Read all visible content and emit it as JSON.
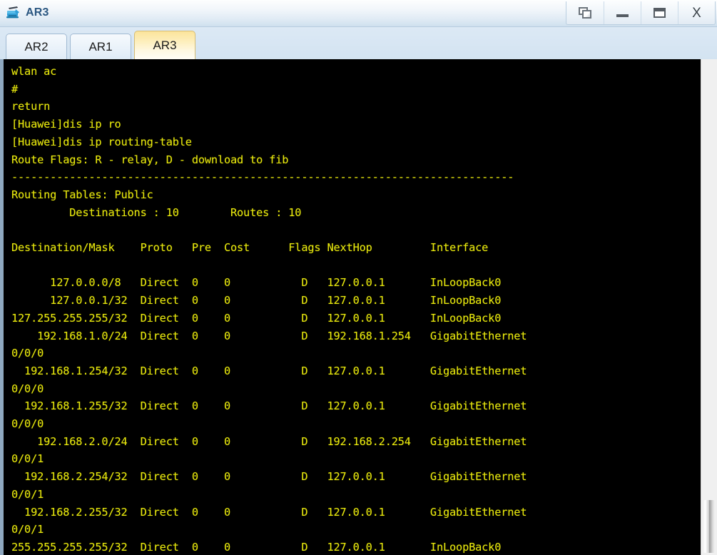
{
  "window": {
    "title": "AR3",
    "icon": "router-icon",
    "controls": [
      {
        "name": "restore-button",
        "label": "Restore",
        "glyph": "restore-icon"
      },
      {
        "name": "minimize-button",
        "label": "Minimize",
        "glyph": "minimize-icon"
      },
      {
        "name": "maximize-button",
        "label": "Maximize",
        "glyph": "maximize-icon"
      },
      {
        "name": "close-button",
        "label": "X",
        "glyph": "close-icon"
      }
    ]
  },
  "tabs": [
    {
      "label": "AR2",
      "active": false
    },
    {
      "label": "AR1",
      "active": false
    },
    {
      "label": "AR3",
      "active": true
    }
  ],
  "terminal": {
    "foreground": "#e8e80d",
    "background": "#000000",
    "lines": [
      "wlan ac",
      "#",
      "return",
      "[Huawei]dis ip ro",
      "[Huawei]dis ip routing-table",
      "Route Flags: R - relay, D - download to fib",
      "------------------------------------------------------------------------------",
      "Routing Tables: Public",
      "         Destinations : 10        Routes : 10",
      "",
      "Destination/Mask    Proto   Pre  Cost      Flags NextHop         Interface",
      "",
      "      127.0.0.0/8   Direct  0    0           D   127.0.0.1       InLoopBack0",
      "      127.0.0.1/32  Direct  0    0           D   127.0.0.1       InLoopBack0",
      "127.255.255.255/32  Direct  0    0           D   127.0.0.1       InLoopBack0",
      "    192.168.1.0/24  Direct  0    0           D   192.168.1.254   GigabitEthernet",
      "0/0/0",
      "  192.168.1.254/32  Direct  0    0           D   127.0.0.1       GigabitEthernet",
      "0/0/0",
      "  192.168.1.255/32  Direct  0    0           D   127.0.0.1       GigabitEthernet",
      "0/0/0",
      "    192.168.2.0/24  Direct  0    0           D   192.168.2.254   GigabitEthernet",
      "0/0/1",
      "  192.168.2.254/32  Direct  0    0           D   127.0.0.1       GigabitEthernet",
      "0/0/1",
      "  192.168.2.255/32  Direct  0    0           D   127.0.0.1       GigabitEthernet",
      "0/0/1",
      "255.255.255.255/32  Direct  0    0           D   127.0.0.1       InLoopBack0"
    ],
    "commands": [
      "dis ip ro",
      "dis ip routing-table"
    ],
    "prompt": "[Huawei]",
    "route_flags_legend": "Route Flags: R - relay, D - download to fib",
    "routing_table_scope": "Routing Tables: Public",
    "destinations_count": "10",
    "routes_count": "10",
    "columns": [
      "Destination/Mask",
      "Proto",
      "Pre",
      "Cost",
      "Flags",
      "NextHop",
      "Interface"
    ],
    "rows": [
      {
        "destination": "127.0.0.0/8",
        "proto": "Direct",
        "pre": "0",
        "cost": "0",
        "flags": "D",
        "nexthop": "127.0.0.1",
        "interface": "InLoopBack0"
      },
      {
        "destination": "127.0.0.1/32",
        "proto": "Direct",
        "pre": "0",
        "cost": "0",
        "flags": "D",
        "nexthop": "127.0.0.1",
        "interface": "InLoopBack0"
      },
      {
        "destination": "127.255.255.255/32",
        "proto": "Direct",
        "pre": "0",
        "cost": "0",
        "flags": "D",
        "nexthop": "127.0.0.1",
        "interface": "InLoopBack0"
      },
      {
        "destination": "192.168.1.0/24",
        "proto": "Direct",
        "pre": "0",
        "cost": "0",
        "flags": "D",
        "nexthop": "192.168.1.254",
        "interface": "GigabitEthernet0/0/0"
      },
      {
        "destination": "192.168.1.254/32",
        "proto": "Direct",
        "pre": "0",
        "cost": "0",
        "flags": "D",
        "nexthop": "127.0.0.1",
        "interface": "GigabitEthernet0/0/0"
      },
      {
        "destination": "192.168.1.255/32",
        "proto": "Direct",
        "pre": "0",
        "cost": "0",
        "flags": "D",
        "nexthop": "127.0.0.1",
        "interface": "GigabitEthernet0/0/0"
      },
      {
        "destination": "192.168.2.0/24",
        "proto": "Direct",
        "pre": "0",
        "cost": "0",
        "flags": "D",
        "nexthop": "192.168.2.254",
        "interface": "GigabitEthernet0/0/1"
      },
      {
        "destination": "192.168.2.254/32",
        "proto": "Direct",
        "pre": "0",
        "cost": "0",
        "flags": "D",
        "nexthop": "127.0.0.1",
        "interface": "GigabitEthernet0/0/1"
      },
      {
        "destination": "192.168.2.255/32",
        "proto": "Direct",
        "pre": "0",
        "cost": "0",
        "flags": "D",
        "nexthop": "127.0.0.1",
        "interface": "GigabitEthernet0/0/1"
      },
      {
        "destination": "255.255.255.255/32",
        "proto": "Direct",
        "pre": "0",
        "cost": "0",
        "flags": "D",
        "nexthop": "127.0.0.1",
        "interface": "InLoopBack0"
      }
    ]
  },
  "scrollbar": {
    "orientation": "vertical",
    "thumb_name": "vertical-scrollbar-thumb"
  },
  "colors": {
    "terminal_fg": "#e8e80d",
    "terminal_bg": "#000000",
    "active_tab": "#fbe49b",
    "title_text": "#2a5680"
  }
}
